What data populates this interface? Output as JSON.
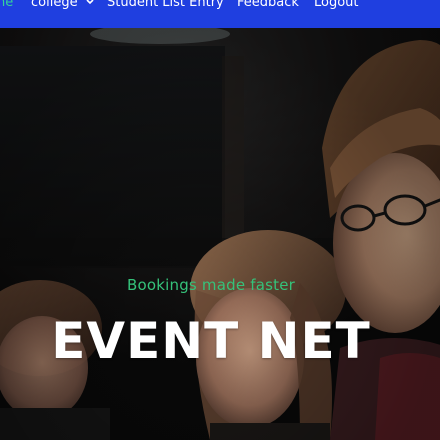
{
  "nav": {
    "items": [
      {
        "label": "ne"
      },
      {
        "label": "college"
      },
      {
        "label": "Student List Entry"
      },
      {
        "label": "Feedback"
      },
      {
        "label": "Logout"
      }
    ],
    "dropdown_icon": "chevron-down-icon"
  },
  "hero": {
    "tagline": "Bookings made faster",
    "title": "EVENT NET"
  },
  "colors": {
    "navbar": "#1f3fe0",
    "nav_active": "#34d39a",
    "tagline": "#35c27a",
    "title": "#ffffff",
    "background": "#0b0b0d"
  }
}
